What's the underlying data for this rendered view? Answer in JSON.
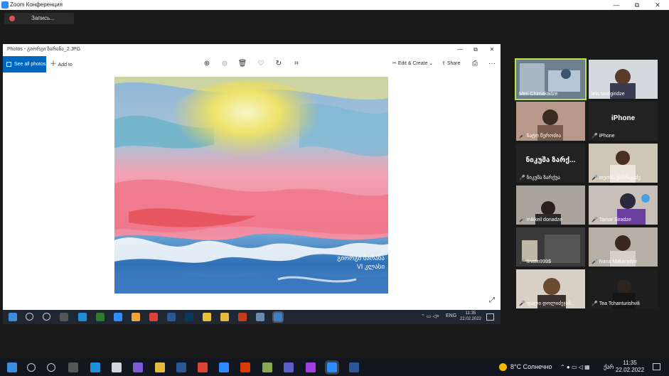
{
  "zoom": {
    "window_title": "Zoom Конференция",
    "recording_label": "Запись...",
    "win_minimize": "—",
    "win_restore": "⧉",
    "win_close": "✕"
  },
  "photos": {
    "title": "Photos - გიორგი ზარანა_2.JPG",
    "see_all": "See all photos",
    "add_to": "Add to",
    "edit_create": "Edit & Create",
    "share": "Share",
    "more": "···",
    "minimize": "—",
    "restore": "⧉",
    "close": "✕",
    "painting_caption_1": "გიორგი ბარანა",
    "painting_caption_2": "VI კლასი",
    "expand": "⤢"
  },
  "remote_taskbar": {
    "lang": "ENG",
    "time": "11:35",
    "date": "22.02.2022"
  },
  "participants": [
    {
      "name": "Meri Chimakadze",
      "muted": false,
      "active": true
    },
    {
      "name": "lela tavdgiridze",
      "muted": false,
      "active": false
    },
    {
      "name": "ნატო წეროძია",
      "muted": true,
      "active": false
    },
    {
      "name": "iPhone",
      "muted": true,
      "active": false,
      "big_label": "iPhone"
    },
    {
      "name": "ნიკუშა ზარქუა",
      "muted": true,
      "active": false,
      "big_label": "ნიკუშა ზარქ..."
    },
    {
      "name": "თეონა ქარჩავაძე",
      "muted": true,
      "active": false
    },
    {
      "name": "mikkeil donadze",
      "muted": true,
      "active": false
    },
    {
      "name": "Tamar Siradze",
      "muted": true,
      "active": false
    },
    {
      "name": "tinatin999$",
      "muted": true,
      "active": false
    },
    {
      "name": "Nana Makaradze",
      "muted": true,
      "active": false
    },
    {
      "name": "ფალი დოლიძეჯიბ...",
      "muted": true,
      "active": false
    },
    {
      "name": "Tea Tchanturishvili",
      "muted": true,
      "active": false
    }
  ],
  "taskbar": {
    "weather": "8°C Солнечно",
    "lang": "ქარ",
    "time": "11:35",
    "date": "22.02.2022"
  },
  "colors": {
    "zoom_blue": "#2d8cff",
    "photos_accent": "#0067c0",
    "active_speaker": "#c2e03a",
    "muted_red": "#e54a4a"
  }
}
